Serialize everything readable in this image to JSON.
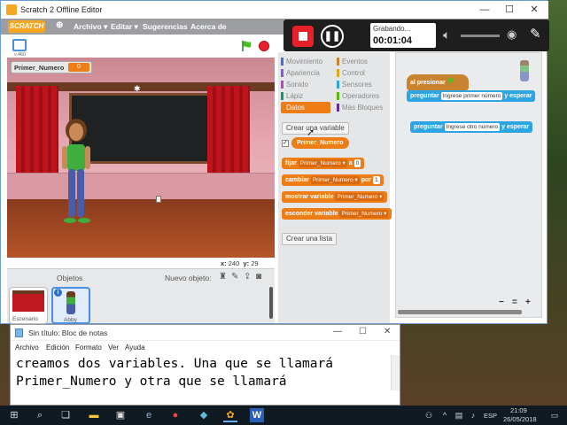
{
  "window": {
    "title": "Scratch 2 Offline Editor",
    "minimize": "—",
    "maximize": "☐",
    "close": "✕"
  },
  "menu": {
    "logo": "SCRATCH",
    "items": [
      "Archivo ▾",
      "Editar ▾",
      "Sugerencias",
      "Acerca de"
    ]
  },
  "stage": {
    "version_label": "v.460",
    "variable_monitor": {
      "name": "Primer_Numero",
      "value": "0"
    },
    "x_label": "x:",
    "x_value": "240",
    "y_label": "y:",
    "y_value": "29"
  },
  "sprites": {
    "header": "Objetos",
    "new_sprite_label": "Nuevo objeto:",
    "stage_thumb_label": "Escenario",
    "sprite_thumb_label": "Abby"
  },
  "palette": {
    "categories_left": [
      "Movimiento",
      "Apariencia",
      "Sonido",
      "Lápiz",
      "Datos"
    ],
    "categories_right": [
      "Eventos",
      "Control",
      "Sensores",
      "Operadores",
      "Más Bloques"
    ],
    "create_variable": "Crear una variable",
    "variable_reporter": "Primer_Numero",
    "blocks": {
      "set": {
        "verb": "fijar",
        "var": "Primer_Numero ▾",
        "a": "a",
        "value": "0"
      },
      "change": {
        "verb": "cambiar",
        "var": "Primer_Numero ▾",
        "por": "por",
        "value": "1"
      },
      "show": {
        "verb": "mostrar variable",
        "var": "Primer_Numero ▾"
      },
      "hide": {
        "verb": "esconder variable",
        "var": "Primer_Numero ▾"
      }
    },
    "create_list": "Crear una lista"
  },
  "scripts": {
    "hat": "al presionar",
    "ask1": {
      "verb": "preguntar",
      "text": "Ingrese primer número",
      "tail": "y esperar"
    },
    "ask2": {
      "verb": "preguntar",
      "text": "Ingrese otro número",
      "tail": "y esperar"
    },
    "zoom": [
      "−",
      "=",
      "+"
    ]
  },
  "recorder": {
    "status": "Grabando...",
    "time": "00:01:04"
  },
  "notepad": {
    "title": "Sin título: Bloc de notas",
    "menu": [
      "Archivo",
      "Edición",
      "Formato",
      "Ver",
      "Ayuda"
    ],
    "line1": "creamos dos variables. Una que se llamará",
    "line2": "Primer_Numero y otra que se llamará"
  },
  "taskbar": {
    "language": "ESP",
    "time": "21:09",
    "date": "26/05/2018"
  },
  "colors": {
    "data_orange": "#ee7d16",
    "motion_blue": "#4a6cd4",
    "sensing_blue": "#2ca5e2",
    "events_brown": "#c88330",
    "looks_purple": "#8a55d7",
    "sound_pink": "#bb42c3",
    "pen_green": "#0e9a6c",
    "control_orange": "#e1a91a",
    "operators_green": "#5cb712",
    "more_purple": "#632d99"
  }
}
